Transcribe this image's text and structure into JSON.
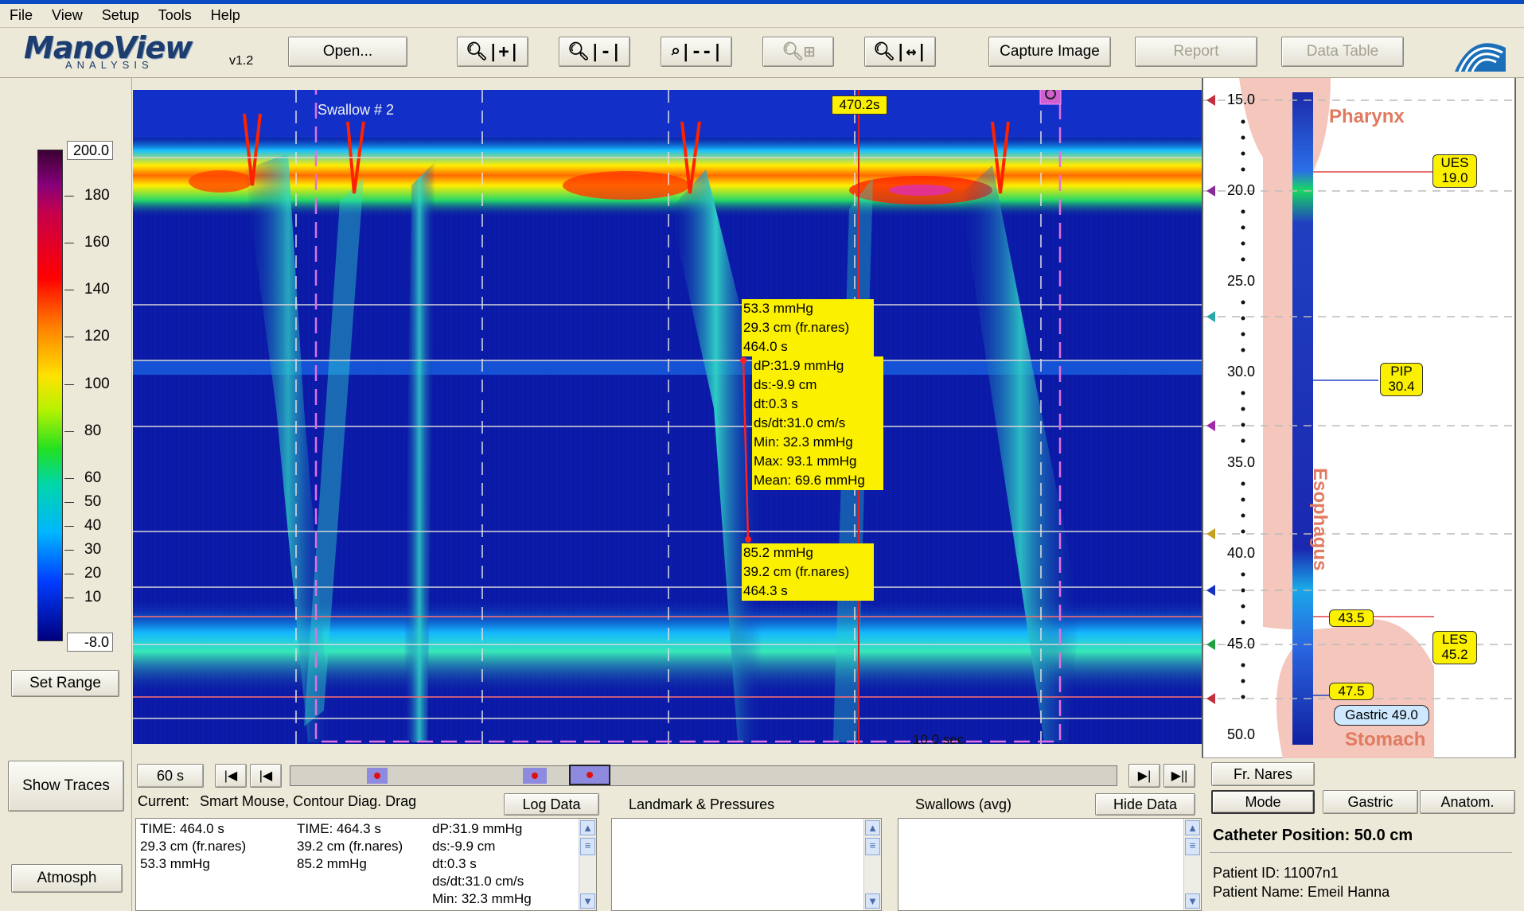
{
  "menu": [
    "File",
    "View",
    "Setup",
    "Tools",
    "Help"
  ],
  "logo": {
    "name": "ManoView",
    "sub": "ANALYSIS",
    "version": "v1.2"
  },
  "toolbar": {
    "open": "Open...",
    "capture": "Capture Image",
    "report": "Report",
    "data_table": "Data Table"
  },
  "colorbar": {
    "max": "200.0",
    "min": "-8.0",
    "ticks": [
      "180",
      "160",
      "140",
      "120",
      "100",
      "80",
      "60",
      "50",
      "40",
      "30",
      "20",
      "10"
    ]
  },
  "set_range": "Set Range",
  "show_traces": "Show Traces",
  "atmosph": "Atmosph",
  "plot": {
    "swallow_label": "Swallow # 2",
    "time_marker": "470.2s",
    "scale_label": "10.0 sec",
    "probe_top": [
      "53.3 mmHg",
      "29.3 cm (fr.nares)",
      "464.0 s"
    ],
    "probe_stats": [
      "dP:31.9 mmHg",
      "ds:-9.9 cm",
      "dt:0.3 s",
      "ds/dt:31.0 cm/s",
      "Min: 32.3 mmHg",
      "Max: 93.1 mmHg",
      "Mean: 69.6 mmHg"
    ],
    "probe_bottom": [
      "85.2 mmHg",
      "39.2 cm (fr.nares)",
      "464.3 s"
    ]
  },
  "anatomy": {
    "depth_ticks": [
      "15.0",
      "20.0",
      "25.0",
      "30.0",
      "35.0",
      "40.0",
      "45.0",
      "50.0"
    ],
    "pharynx": "Pharynx",
    "esophagus": "Esophagus",
    "stomach": "Stomach",
    "ues": {
      "label": "UES",
      "value": "19.0"
    },
    "pip": {
      "label": "PIP",
      "value": "30.4"
    },
    "les": {
      "label": "LES",
      "value": "45.2"
    },
    "les_upper": "43.5",
    "les_lower": "47.5",
    "gastric": "Gastric 49.0"
  },
  "timeline": {
    "window": "60 s"
  },
  "bottom": {
    "current_label": "Current:",
    "current_mode": "Smart Mouse, Contour Diag. Drag",
    "log_data": "Log Data",
    "landmark_header": "Landmark & Pressures",
    "swallows_header": "Swallows (avg)",
    "hide_data": "Hide Data",
    "info_col1": [
      "TIME: 464.0 s",
      "29.3 cm (fr.nares)",
      "53.3 mmHg"
    ],
    "info_col2": [
      "TIME: 464.3 s",
      "39.2 cm (fr.nares)",
      "85.2 mmHg"
    ],
    "info_col3": [
      "dP:31.9 mmHg",
      "ds:-9.9 cm",
      "dt:0.3 s",
      "ds/dt:31.0 cm/s",
      "Min: 32.3 mmHg"
    ]
  },
  "right_bottom": {
    "fr_nares": "Fr. Nares",
    "mode": "Mode",
    "gastric": "Gastric",
    "anatom": "Anatom.",
    "catheter_position": "Catheter Position: 50.0 cm",
    "patient_id": "Patient ID: 11007n1",
    "patient_name": "Patient Name: Emeil Hanna"
  },
  "colors": {
    "accent": "#0a4bc4",
    "callout": "#fbf000",
    "anatomy": "#f4c6bc",
    "anatomy_text": "#e07a60"
  }
}
